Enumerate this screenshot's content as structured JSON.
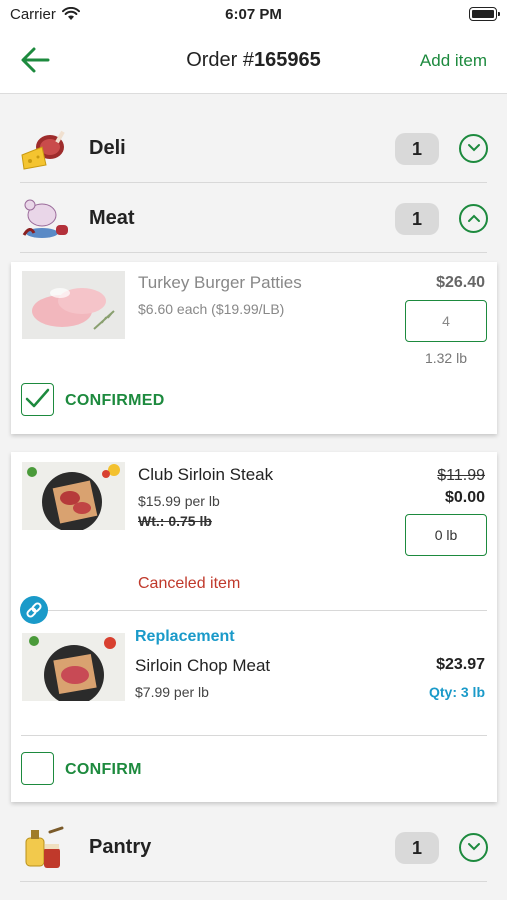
{
  "status_bar": {
    "carrier": "Carrier",
    "time": "6:07 PM"
  },
  "nav": {
    "title_prefix": "Order #",
    "order_number": "165965",
    "add_item": "Add item"
  },
  "colors": {
    "accent": "#1d8a3e",
    "replacement": "#1a9ac9",
    "canceled": "#c0392b"
  },
  "categories": [
    {
      "name": "Deli",
      "count": "1",
      "icon": "deli-icon",
      "expanded": false
    },
    {
      "name": "Meat",
      "count": "1",
      "icon": "meat-icon",
      "expanded": true
    },
    {
      "name": "Pantry",
      "count": "1",
      "icon": "pantry-icon",
      "expanded": false
    }
  ],
  "items": [
    {
      "name": "Turkey Burger Patties",
      "unit_price": "$6.60 each ($19.99/LB)",
      "price": "$26.40",
      "qty": "4",
      "weight": "1.32 lb",
      "status_label": "CONFIRMED",
      "confirmed": true
    },
    {
      "name": "Club Sirloin Steak",
      "unit_price": "$15.99 per lb",
      "weight_struck": "Wt.: 0.75 lb",
      "old_price": "$11.99",
      "price": "$0.00",
      "qty": "0 lb",
      "canceled_label": "Canceled item",
      "replacement": {
        "label": "Replacement",
        "name": "Sirloin Chop Meat",
        "unit_price": "$7.99 per lb",
        "price": "$23.97",
        "qty": "Qty: 3 lb"
      },
      "status_label": "CONFIRM",
      "confirmed": false
    }
  ]
}
